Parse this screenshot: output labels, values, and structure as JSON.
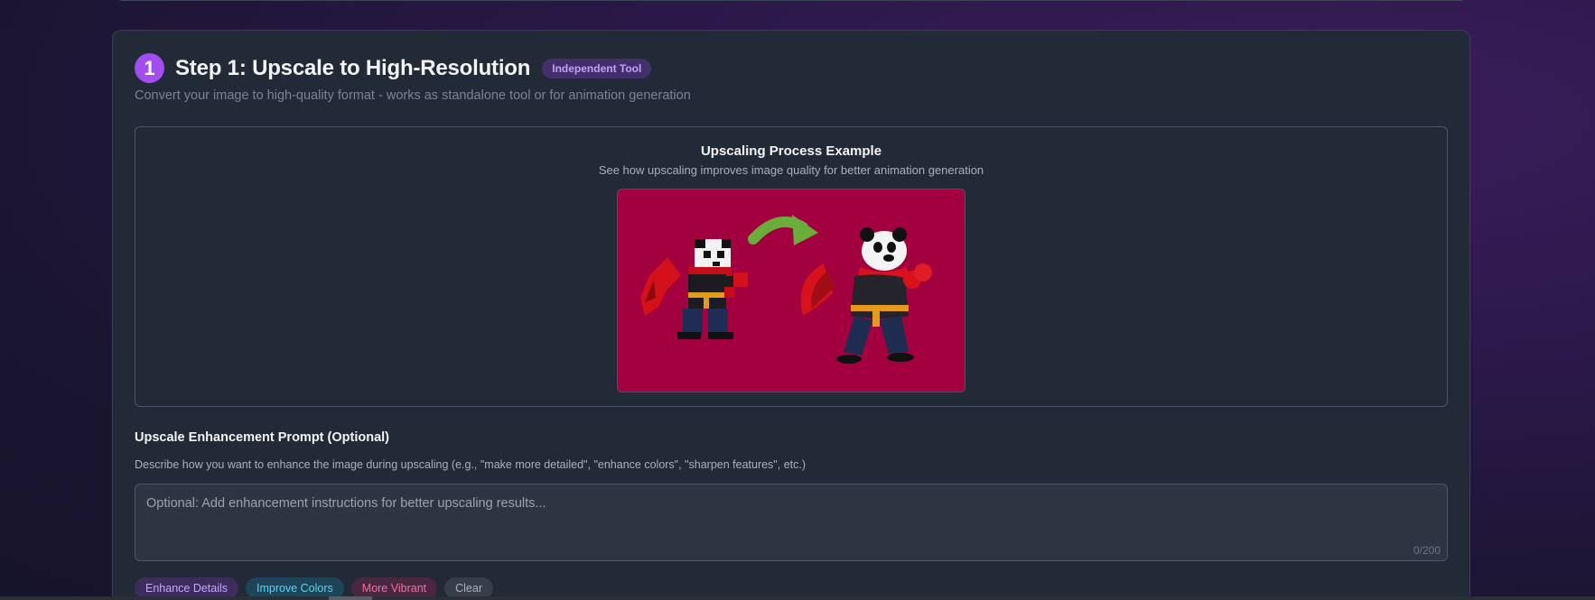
{
  "step": {
    "number": "1",
    "title": "Step 1: Upscale to High-Resolution",
    "badge": "Independent Tool",
    "subtitle": "Convert your image to high-quality format - works as standalone tool or for animation generation"
  },
  "example": {
    "title": "Upscaling Process Example",
    "description": "See how upscaling improves image quality for better animation generation",
    "image_icon": "panda-upscale-comparison-image"
  },
  "prompt": {
    "label": "Upscale Enhancement Prompt (Optional)",
    "help": "Describe how you want to enhance the image during upscaling (e.g., \"make more detailed\", \"enhance colors\", \"sharpen features\", etc.)",
    "placeholder": "Optional: Add enhancement instructions for better upscaling results...",
    "value": "",
    "counter": "0/200"
  },
  "chips": [
    {
      "label": "Enhance Details",
      "color": "#c9a6fb"
    },
    {
      "label": "Improve Colors",
      "color": "#5bd3ef"
    },
    {
      "label": "More Vibrant",
      "color": "#f06fa6"
    },
    {
      "label": "Clear",
      "color": "#aab2be"
    }
  ],
  "colors": {
    "accent": "#a24df0",
    "card_bg": "#232a37",
    "image_bg": "#a3003f"
  }
}
